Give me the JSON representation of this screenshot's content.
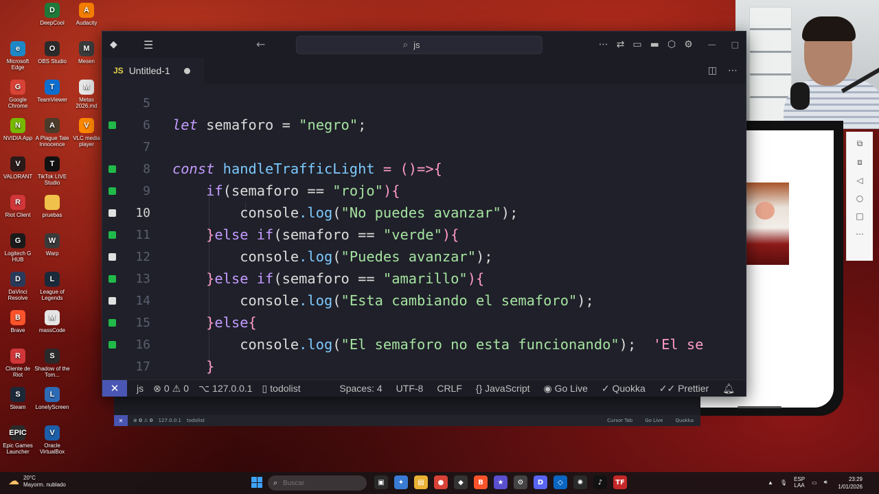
{
  "desktop": {
    "icons": [
      {
        "label": "DeepCool",
        "color": "#1f7a3a",
        "glyph": "D"
      },
      {
        "label": "Audacity",
        "color": "#f27d00",
        "glyph": "A"
      },
      {
        "label": "Microsoft Edge",
        "color": "#1e88c7",
        "glyph": "e"
      },
      {
        "label": "OBS Studio",
        "color": "#2b2b2b",
        "glyph": "O"
      },
      {
        "label": "Mesen",
        "color": "#3c3c3c",
        "glyph": "M"
      },
      {
        "label": "Google Chrome",
        "color": "#d94236",
        "glyph": "G"
      },
      {
        "label": "TeamViewer",
        "color": "#0e6ecf",
        "glyph": "T"
      },
      {
        "label": "Metas 2026.md",
        "color": "#e8e8e8",
        "glyph": "M"
      },
      {
        "label": "NVIDIA App",
        "color": "#76b900",
        "glyph": "N"
      },
      {
        "label": "A Plague Tale Innocence",
        "color": "#4a3b2a",
        "glyph": "A"
      },
      {
        "label": "VLC media player",
        "color": "#ff8800",
        "glyph": "V"
      },
      {
        "label": "VALORANT",
        "color": "#2a1a1a",
        "glyph": "V"
      },
      {
        "label": "TikTok LIVE Studio",
        "color": "#111111",
        "glyph": "T"
      },
      {
        "label": "Riot Client",
        "color": "#d13639",
        "glyph": "R"
      },
      {
        "label": "pruebas",
        "color": "#f0c24b",
        "glyph": ""
      },
      {
        "label": "Logitech G HUB",
        "color": "#1a1a1a",
        "glyph": "G"
      },
      {
        "label": "Warp",
        "color": "#3a3a3a",
        "glyph": "W"
      },
      {
        "label": "DaVinci Resolve",
        "color": "#2a3a5a",
        "glyph": "D"
      },
      {
        "label": "League of Legends",
        "color": "#1a2a3a",
        "glyph": "L"
      },
      {
        "label": "Brave",
        "color": "#fb542b",
        "glyph": "B"
      },
      {
        "label": "massCode",
        "color": "#e5e5e5",
        "glyph": "M"
      },
      {
        "label": "Cliente de Riot",
        "color": "#d13639",
        "glyph": "R"
      },
      {
        "label": "Shadow of the Tom...",
        "color": "#2a2a2a",
        "glyph": "S"
      },
      {
        "label": "Steam",
        "color": "#1b2838",
        "glyph": "S"
      },
      {
        "label": "LonelyScreen",
        "color": "#2d6ab5",
        "glyph": "L"
      },
      {
        "label": "Epic Games Launcher",
        "color": "#2a2a2a",
        "glyph": "EPIC"
      },
      {
        "label": "Oracle VirtualBox",
        "color": "#1d5ea8",
        "glyph": "V"
      }
    ]
  },
  "vscode": {
    "search_text": "js",
    "tab": {
      "badge": "JS",
      "name": "Untitled-1"
    },
    "lines": [
      {
        "num": "5",
        "marker": "none"
      },
      {
        "num": "6",
        "marker": "green"
      },
      {
        "num": "7",
        "marker": "none"
      },
      {
        "num": "8",
        "marker": "green"
      },
      {
        "num": "9",
        "marker": "green"
      },
      {
        "num": "10",
        "marker": "white"
      },
      {
        "num": "11",
        "marker": "green"
      },
      {
        "num": "12",
        "marker": "white"
      },
      {
        "num": "13",
        "marker": "green"
      },
      {
        "num": "14",
        "marker": "white"
      },
      {
        "num": "15",
        "marker": "green"
      },
      {
        "num": "16",
        "marker": "green"
      },
      {
        "num": "17",
        "marker": "none"
      }
    ],
    "code": {
      "l6_kw": "let",
      "l6_rest": " semaforo = ",
      "l6_str": "\"negro\"",
      "l6_end": ";",
      "l8_kw": "const",
      "l8_fn": " handleTrafficLight",
      "l8_op": " = ",
      "l8_brace": "()=>{",
      "l9_kw": "if",
      "l9_a": "(semaforo == ",
      "l9_str": "\"rojo\"",
      "l9_b": "){",
      "l10_obj": "console",
      "l10_m": ".log",
      "l10_p": "(",
      "l10_str": "\"No puedes avanzar\"",
      "l10_e": ");",
      "l11_a": "}",
      "l11_kw": "else if",
      "l11_b": "(semaforo == ",
      "l11_str": "\"verde\"",
      "l11_c": "){",
      "l12_obj": "console",
      "l12_m": ".log",
      "l12_p": "(",
      "l12_str": "\"Puedes avanzar\"",
      "l12_e": ");",
      "l13_a": "}",
      "l13_kw": "else if",
      "l13_b": "(semaforo == ",
      "l13_str": "\"amarillo\"",
      "l13_c": "){",
      "l14_obj": "console",
      "l14_m": ".log",
      "l14_p": "(",
      "l14_str": "\"Esta cambiando el semaforo\"",
      "l14_e": ");",
      "l15_a": "}",
      "l15_kw": "else",
      "l15_b": "{",
      "l16_obj": "console",
      "l16_m": ".log",
      "l16_p": "(",
      "l16_str": "\"El semaforo no esta funcionando\"",
      "l16_e": ");",
      "l16_tip": "'El se",
      "l17": "}"
    },
    "status": {
      "lang_short": "js",
      "errors": "0",
      "warnings": "0",
      "host": "127.0.0.1",
      "repo": "todolist",
      "spaces": "Spaces: 4",
      "encoding": "UTF-8",
      "eol": "CRLF",
      "language": "JavaScript",
      "golive": "Go Live",
      "quokka": "Quokka",
      "prettier": "Prettier"
    }
  },
  "behind_status": {
    "errors": "0",
    "warnings": "0",
    "host": "127.0.0.1",
    "repo": "todolist",
    "cursor_tab": "Cursor Tab",
    "golive": "Go Live",
    "quokka": "Quokka"
  },
  "taskbar": {
    "temp": "20°C",
    "weather": "Mayorm. nublado",
    "search_placeholder": "Buscar",
    "lang_1": "ESP",
    "lang_2": "LAA",
    "time": "23:29",
    "date": "1/01/2026"
  },
  "colors": {
    "accent": "#4a56b3",
    "git_added": "#21b94a",
    "string": "#a6e3a1",
    "keyword": "#c49bff"
  }
}
